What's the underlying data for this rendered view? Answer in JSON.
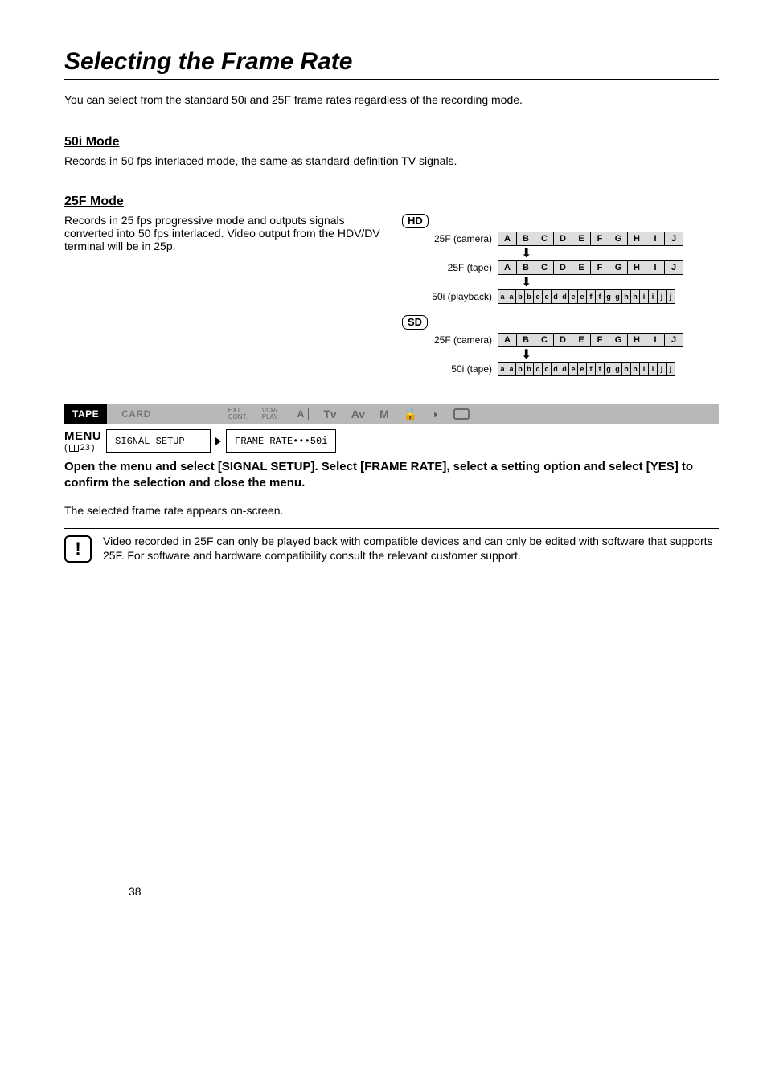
{
  "title": "Selecting the Frame Rate",
  "intro": "You can select from the standard 50i and 25F frame rates regardless of the recording mode.",
  "mode50i": {
    "heading": "50i Mode",
    "text": "Records in 50 fps interlaced mode, the same as standard-definition TV signals."
  },
  "mode25f": {
    "heading": "25F Mode",
    "text": "Records in 25 fps progressive mode and outputs signals converted into 50 fps interlaced. Video output from the HDV/DV terminal will be in 25p."
  },
  "hd_badge": "HD",
  "sd_badge": "SD",
  "labels": {
    "cam25f": "25F (camera)",
    "tape25f": "25F (tape)",
    "play50i": "50i (playback)",
    "tape50i": "50i (tape)"
  },
  "cells_upper": [
    "A",
    "B",
    "C",
    "D",
    "E",
    "F",
    "G",
    "H",
    "I",
    "J"
  ],
  "cells_doubled": [
    "a",
    "a",
    "b",
    "b",
    "c",
    "c",
    "d",
    "d",
    "e",
    "e",
    "f",
    "f",
    "g",
    "g",
    "h",
    "h",
    "i",
    "i",
    "j",
    "j"
  ],
  "bar": {
    "tape": "TAPE",
    "card": "CARD",
    "ext": "EXT.\nCONT.",
    "vcr": "VCR/\nPLAY",
    "A": "A",
    "tv": "Tv",
    "av": "Av",
    "m": "M"
  },
  "menu": {
    "label": "MENU",
    "ref": "23",
    "box1": "SIGNAL SETUP",
    "box2": "FRAME RATE•••50i"
  },
  "instruction": "Open the menu and select [SIGNAL SETUP]. Select [FRAME RATE], select a setting option and select [YES] to confirm the selection and close the menu.",
  "note": "The selected frame rate appears on-screen.",
  "warning": "Video recorded in 25F can only be played back with compatible devices and can only be edited with software that supports 25F. For software and hardware compatibility consult the relevant customer support.",
  "page_number": "38"
}
